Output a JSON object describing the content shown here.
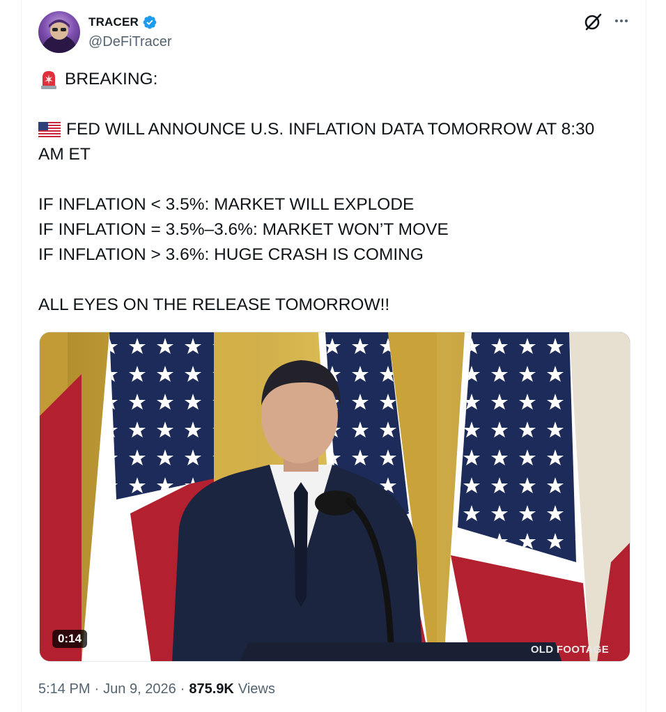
{
  "author": {
    "name": "TRACER",
    "handle": "@DeFiTracer",
    "verified": true
  },
  "icons": {
    "verified": "verified-badge-icon",
    "grok": "grok-icon",
    "more": "more-icon",
    "siren": "siren-emoji",
    "flag": "us-flag-emoji"
  },
  "tweet": {
    "line1": "BREAKING:",
    "line2a": "FED WILL ANNOUNCE U.S. INFLATION DATA TOMORROW AT 8:30",
    "line2b": "AM ET",
    "line3": "IF INFLATION < 3.5%: MARKET WILL EXPLODE",
    "line4": "IF INFLATION = 3.5%–3.6%: MARKET WON’T MOVE",
    "line5": "IF INFLATION > 3.6%: HUGE CRASH IS COMING",
    "line6": "ALL EYES ON THE RELEASE TOMORROW!!"
  },
  "media": {
    "duration": "0:14",
    "overlay": "OLD FOOTAGE"
  },
  "meta": {
    "time": "5:14 PM",
    "date": "Jun 9, 2026",
    "views_count": "875.9K",
    "views_label": "Views",
    "sep": "·"
  },
  "colors": {
    "text": "#0f1419",
    "secondary": "#536471",
    "verified_blue": "#1d9bf0"
  }
}
